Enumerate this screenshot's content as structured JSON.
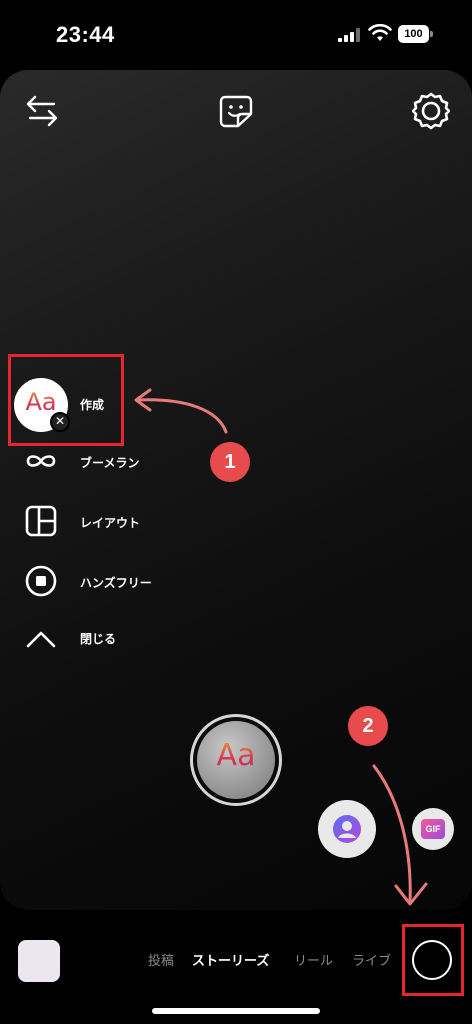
{
  "status_bar": {
    "time": "23:44",
    "battery": "100",
    "icons": [
      "cellular-signal-icon",
      "wifi-icon",
      "battery-icon"
    ]
  },
  "top_controls": {
    "icons": [
      "swap-icon",
      "sticker-icon",
      "settings-icon"
    ]
  },
  "side_menu": {
    "items": [
      {
        "label": "作成",
        "icon": "create-aa-icon"
      },
      {
        "label": "ブーメラン",
        "icon": "infinity-icon"
      },
      {
        "label": "レイアウト",
        "icon": "layout-icon"
      },
      {
        "label": "ハンズフリー",
        "icon": "hands-free-icon"
      },
      {
        "label": "閉じる",
        "icon": "chevron-up-icon"
      }
    ]
  },
  "annotations": {
    "step1": "1",
    "step2": "2",
    "highlight_color": "#e5262d",
    "badge_color": "#e84b4b"
  },
  "shutter": {
    "label": "Aa"
  },
  "create_avatar": {
    "label": "Aa",
    "close": "✕"
  },
  "effects": {
    "gif_label": "GIF",
    "icons": [
      "avatar-effect-icon",
      "gif-effect-icon"
    ]
  },
  "mode_tabs": [
    {
      "label": "投稿",
      "active": false
    },
    {
      "label": "ストーリーズ",
      "active": true
    },
    {
      "label": "リール",
      "active": false
    },
    {
      "label": "ライブ",
      "active": false
    }
  ]
}
